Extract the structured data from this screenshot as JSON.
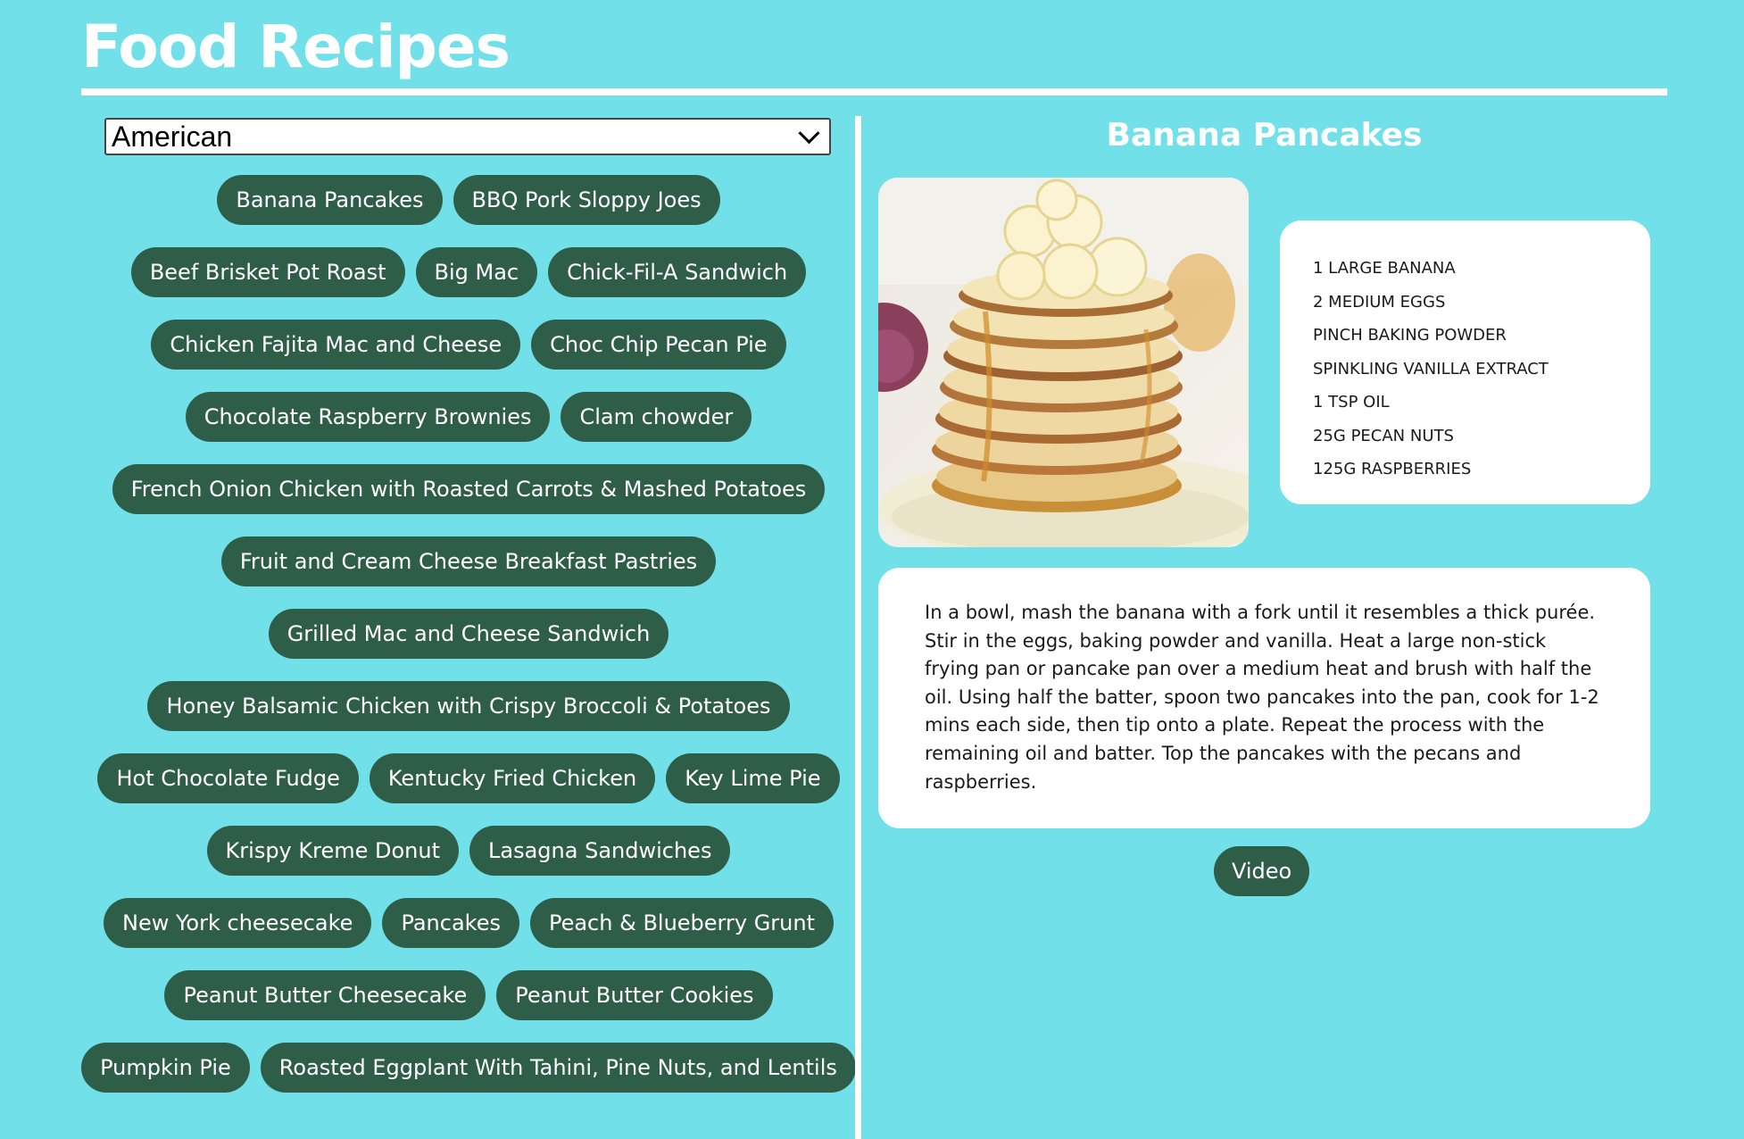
{
  "app": {
    "title": "Food Recipes"
  },
  "cuisine_select": {
    "selected": "American"
  },
  "recipes": [
    "Banana Pancakes",
    "BBQ Pork Sloppy Joes",
    "Beef Brisket Pot Roast",
    "Big Mac",
    "Chick-Fil-A Sandwich",
    "Chicken Fajita Mac and Cheese",
    "Choc Chip Pecan Pie",
    "Chocolate Raspberry Brownies",
    "Clam chowder",
    "French Onion Chicken with Roasted Carrots & Mashed Potatoes",
    "Fruit and Cream Cheese Breakfast Pastries",
    "Grilled Mac and Cheese Sandwich",
    "Honey Balsamic Chicken with Crispy Broccoli & Potatoes",
    "Hot Chocolate Fudge",
    "Kentucky Fried Chicken",
    "Key Lime Pie",
    "Krispy Kreme Donut",
    "Lasagna Sandwiches",
    "New York cheesecake",
    "Pancakes",
    "Peach & Blueberry Grunt",
    "Peanut Butter Cheesecake",
    "Peanut Butter Cookies",
    "Pumpkin Pie",
    "Roasted Eggplant With Tahini, Pine Nuts, and Lentils"
  ],
  "selected_recipe": {
    "title": "Banana Pancakes",
    "ingredients": [
      "1 large banana",
      "2 medium eggs",
      "pinch baking powder",
      "spinkling vanilla extract",
      "1 tsp oil",
      "25g pecan nuts",
      "125g raspberries"
    ],
    "instructions": "In a bowl, mash the banana with a fork until it resembles a thick purée. Stir in the eggs, baking powder and vanilla. Heat a large non-stick frying pan or pancake pan over a medium heat and brush with half the oil. Using half the batter, spoon two pancakes into the pan, cook for 1-2 mins each side, then tip onto a plate. Repeat the process with the remaining oil and batter. Top the pancakes with the pecans and raspberries.",
    "video_label": "Video"
  },
  "colors": {
    "background": "#72e0e8",
    "pill": "#2f5e48",
    "card": "#ffffff"
  }
}
